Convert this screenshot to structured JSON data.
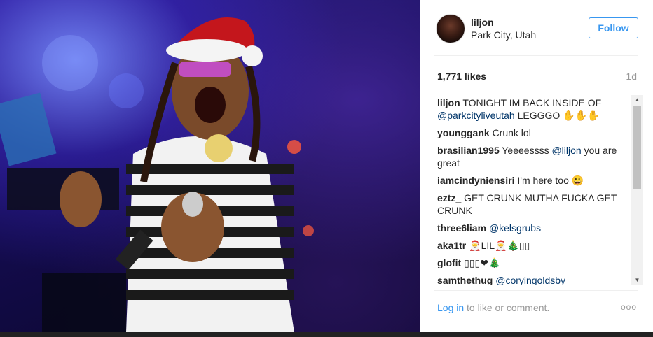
{
  "post": {
    "username": "liljon",
    "location": "Park City, Utah",
    "follow_label": "Follow",
    "likes": "1,771 likes",
    "time": "1d"
  },
  "comments": [
    {
      "user": "liljon",
      "text": "TONIGHT IM BACK INSIDE OF ",
      "mention": "@parkcityliveutah",
      "after": " LEGGGO ✋✋✋"
    },
    {
      "user": "younggank",
      "text": "Crunk lol",
      "mention": "",
      "after": ""
    },
    {
      "user": "brasilian1995",
      "text": "Yeeeessss ",
      "mention": "@liljon",
      "after": " you are great"
    },
    {
      "user": "iamcindyniensiri",
      "text": "I'm here too 😃",
      "mention": "",
      "after": ""
    },
    {
      "user": "eztz_",
      "text": "GET CRUNK MUTHA FUCKA GET CRUNK",
      "mention": "",
      "after": ""
    },
    {
      "user": "three6liam",
      "text": "",
      "mention": "@kelsgrubs",
      "after": ""
    },
    {
      "user": "aka1tr",
      "text": "🎅LIL🎅🎄▯▯",
      "mention": "",
      "after": ""
    },
    {
      "user": "glofit",
      "text": "▯▯▯❤🎄",
      "mention": "",
      "after": ""
    },
    {
      "user": "samthethug",
      "text": "",
      "mention": "@coryingoldsby",
      "after": ""
    }
  ],
  "footer": {
    "login_link": "Log in",
    "login_rest": " to like or comment.",
    "more": "ooo"
  },
  "icons": {
    "scroll_up": "scroll-up-arrow",
    "scroll_down": "scroll-down-arrow"
  }
}
